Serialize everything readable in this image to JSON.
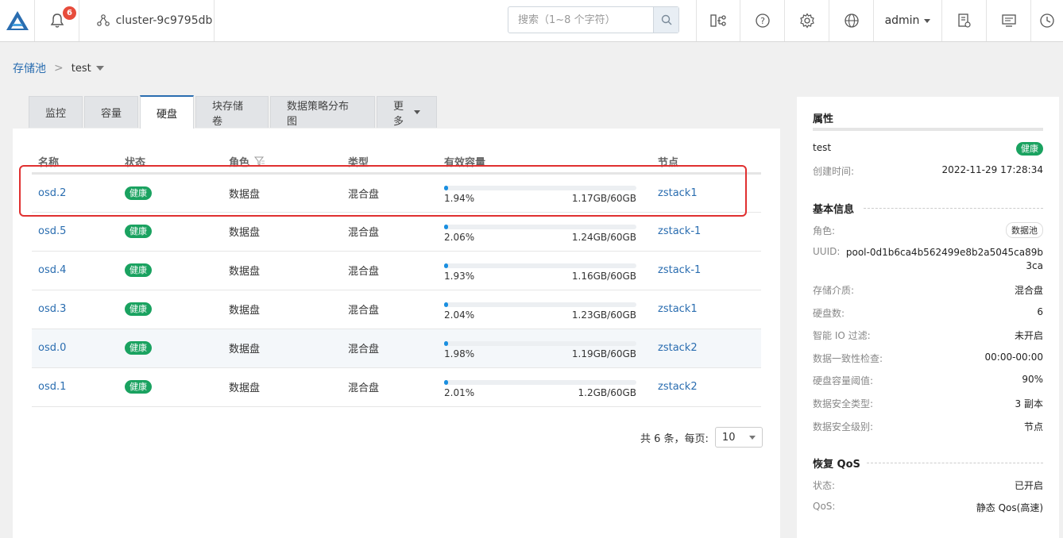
{
  "topbar": {
    "notifications": "6",
    "cluster": "cluster-9c9795db",
    "search_placeholder": "搜索（1~8 个字符）",
    "user": "admin"
  },
  "breadcrumb": {
    "root": "存储池",
    "sep": ">",
    "current": "test"
  },
  "tabs": [
    "监控",
    "容量",
    "硬盘",
    "块存储卷",
    "数据策略分布图",
    "更多"
  ],
  "table": {
    "headers": [
      "名称",
      "状态",
      "角色",
      "类型",
      "有效容量",
      "节点"
    ],
    "rows": [
      {
        "name": "osd.2",
        "status": "健康",
        "role": "数据盘",
        "type": "混合盘",
        "pct": "1.94%",
        "pct_value": 1.94,
        "size": "1.17GB/60GB",
        "node": "zstack1"
      },
      {
        "name": "osd.5",
        "status": "健康",
        "role": "数据盘",
        "type": "混合盘",
        "pct": "2.06%",
        "pct_value": 2.06,
        "size": "1.24GB/60GB",
        "node": "zstack-1"
      },
      {
        "name": "osd.4",
        "status": "健康",
        "role": "数据盘",
        "type": "混合盘",
        "pct": "1.93%",
        "pct_value": 1.93,
        "size": "1.16GB/60GB",
        "node": "zstack-1"
      },
      {
        "name": "osd.3",
        "status": "健康",
        "role": "数据盘",
        "type": "混合盘",
        "pct": "2.04%",
        "pct_value": 2.04,
        "size": "1.23GB/60GB",
        "node": "zstack1"
      },
      {
        "name": "osd.0",
        "status": "健康",
        "role": "数据盘",
        "type": "混合盘",
        "pct": "1.98%",
        "pct_value": 1.98,
        "size": "1.19GB/60GB",
        "node": "zstack2"
      },
      {
        "name": "osd.1",
        "status": "健康",
        "role": "数据盘",
        "type": "混合盘",
        "pct": "2.01%",
        "pct_value": 2.01,
        "size": "1.2GB/60GB",
        "node": "zstack2"
      }
    ]
  },
  "pager": {
    "total": "共 6 条，每页:",
    "page_size": "10"
  },
  "side": {
    "attr_title": "属性",
    "name": "test",
    "status": "健康",
    "created_label": "创建时间:",
    "created": "2022-11-29 17:28:34",
    "basic_title": "基本信息",
    "role_label": "角色:",
    "role": "数据池",
    "uuid_label": "UUID:",
    "uuid_1": "pool-0d1b6ca4b562499e8b2a5045ca89b",
    "uuid_2": "3ca",
    "medium_label": "存储介质:",
    "medium": "混合盘",
    "disks_label": "硬盘数:",
    "disks": "6",
    "io_label": "智能 IO 过滤:",
    "io": "未开启",
    "check_label": "数据一致性检查:",
    "check": "00:00-00:00",
    "thresh_label": "硬盘容量阈值:",
    "thresh": "90%",
    "safe_type_label": "数据安全类型:",
    "safe_type": "3 副本",
    "safe_level_label": "数据安全级别:",
    "safe_level": "节点",
    "qos_title": "恢复 QoS",
    "qos_state_label": "状态:",
    "qos_state": "已开启",
    "qos_label": "QoS:",
    "qos": "静态 Qos(高速)"
  }
}
